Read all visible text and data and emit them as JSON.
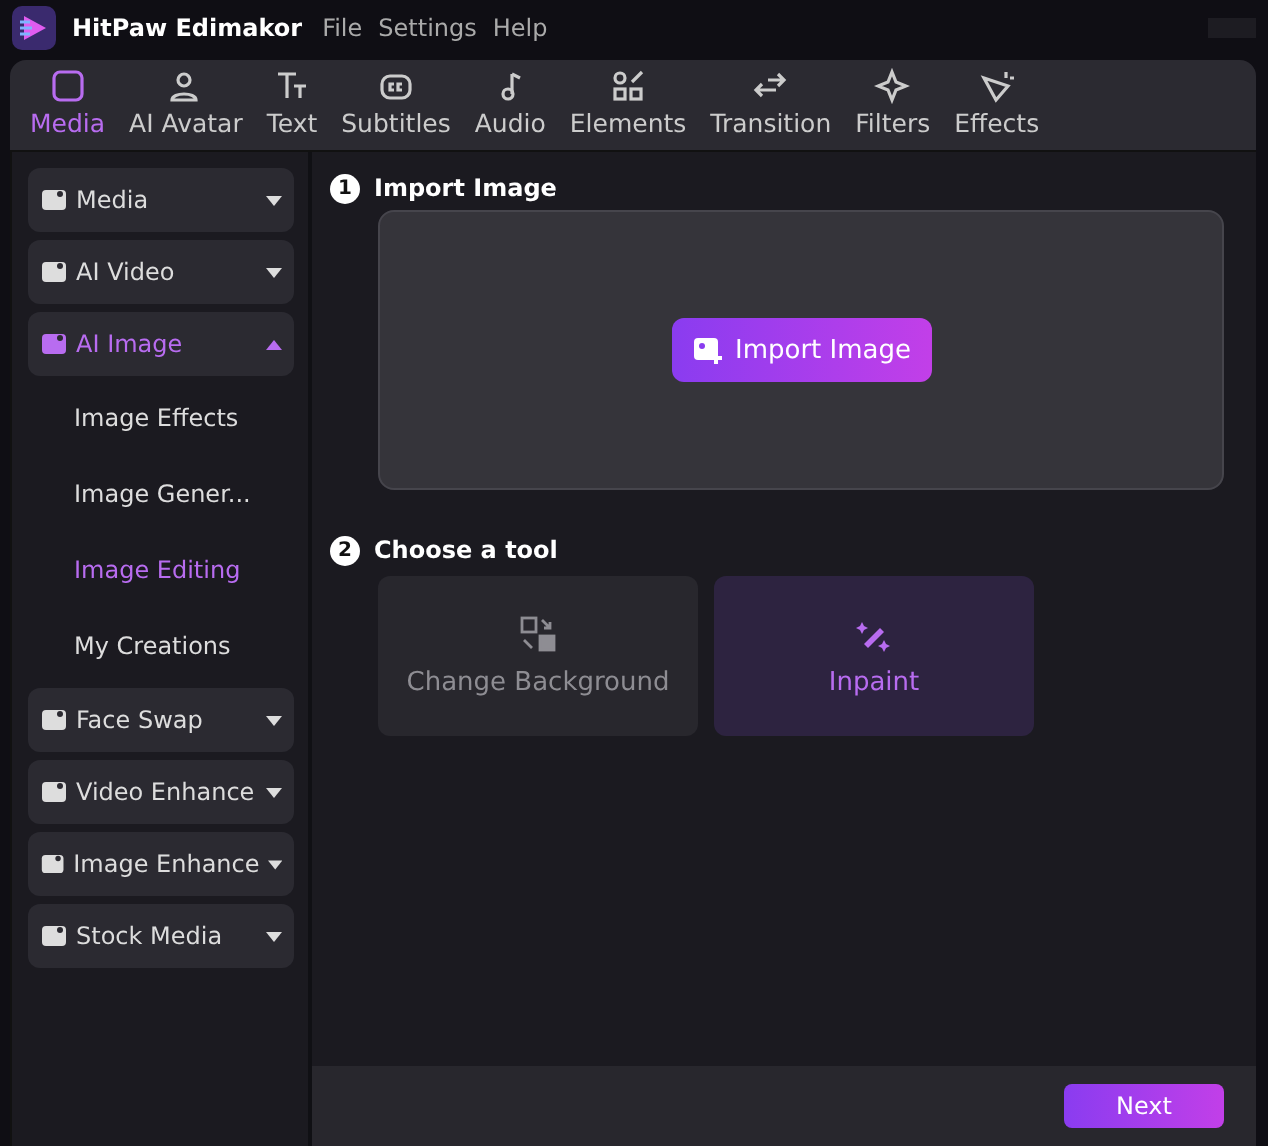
{
  "app": {
    "title": "HitPaw Edimakor"
  },
  "menu": [
    "File",
    "Settings",
    "Help"
  ],
  "tabs": [
    {
      "label": "Media",
      "selected": true
    },
    {
      "label": "AI Avatar",
      "selected": false
    },
    {
      "label": "Text",
      "selected": false
    },
    {
      "label": "Subtitles",
      "selected": false
    },
    {
      "label": "Audio",
      "selected": false
    },
    {
      "label": "Elements",
      "selected": false
    },
    {
      "label": "Transition",
      "selected": false
    },
    {
      "label": "Filters",
      "selected": false
    },
    {
      "label": "Effects",
      "selected": false
    }
  ],
  "sidebar": {
    "items": [
      {
        "label": "Media",
        "selected": false,
        "expanded": false
      },
      {
        "label": "AI Video",
        "selected": false,
        "expanded": false
      },
      {
        "label": "AI Image",
        "selected": true,
        "expanded": true,
        "children": [
          {
            "label": "Image Effects",
            "selected": false
          },
          {
            "label": "Image Gener...",
            "selected": false
          },
          {
            "label": "Image Editing",
            "selected": true
          },
          {
            "label": "My Creations",
            "selected": false
          }
        ]
      },
      {
        "label": "Face Swap",
        "selected": false,
        "expanded": false
      },
      {
        "label": "Video Enhance",
        "selected": false,
        "expanded": false
      },
      {
        "label": "Image Enhance",
        "selected": false,
        "expanded": false
      },
      {
        "label": "Stock Media",
        "selected": false,
        "expanded": false
      }
    ]
  },
  "steps": [
    {
      "number": "1",
      "title": "Import Image"
    },
    {
      "number": "2",
      "title": "Choose a tool"
    }
  ],
  "import_button": "Import Image",
  "tools": [
    {
      "label": "Change Background",
      "selected": false
    },
    {
      "label": "Inpaint",
      "selected": true
    }
  ],
  "next_button": "Next"
}
